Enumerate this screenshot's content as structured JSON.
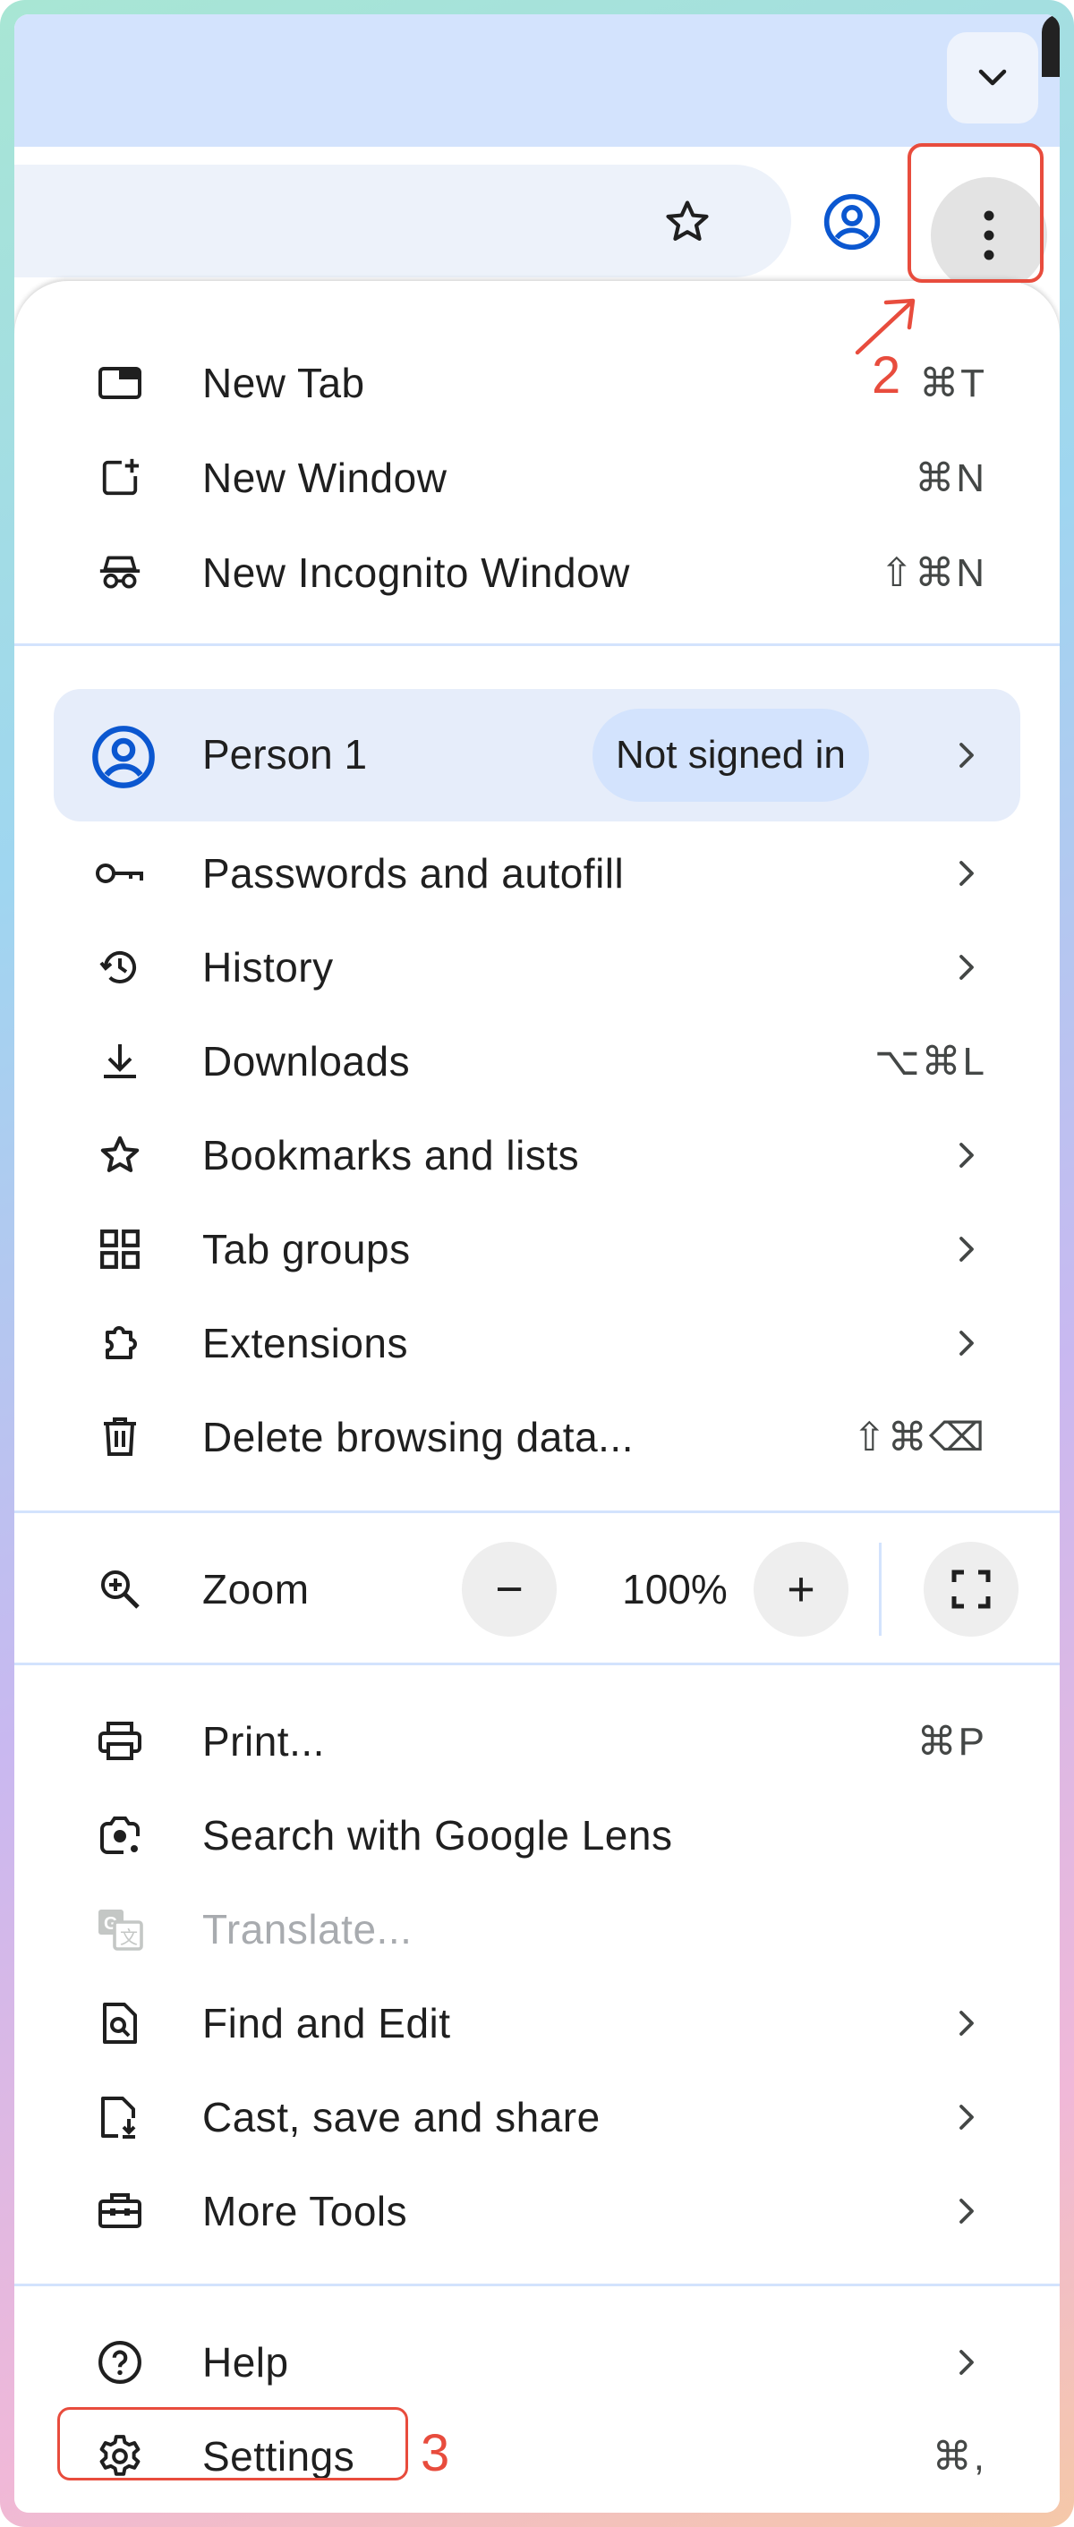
{
  "toolbar": {
    "tab_dropdown_icon": "chevron-down-icon",
    "bookmark_icon": "star-outline-icon",
    "profile_icon": "account-circle-icon",
    "menu_icon": "vertical-dots-icon"
  },
  "menu": {
    "group1": [
      {
        "icon": "new-tab-icon",
        "label": "New Tab",
        "shortcut": "⌘T"
      },
      {
        "icon": "new-window-icon",
        "label": "New Window",
        "shortcut": "⌘N"
      },
      {
        "icon": "incognito-icon",
        "label": "New Incognito Window",
        "shortcut": "⇧⌘N"
      }
    ],
    "profile": {
      "name": "Person 1",
      "status": "Not signed in"
    },
    "group2": [
      {
        "icon": "key-icon",
        "label": "Passwords and autofill"
      },
      {
        "icon": "history-icon",
        "label": "History"
      },
      {
        "icon": "download-icon",
        "label": "Downloads",
        "shortcut": "⌥⌘L"
      },
      {
        "icon": "star-icon",
        "label": "Bookmarks and lists"
      },
      {
        "icon": "tab-groups-icon",
        "label": "Tab groups"
      },
      {
        "icon": "extensions-icon",
        "label": "Extensions"
      },
      {
        "icon": "trash-icon",
        "label": "Delete browsing data...",
        "shortcut": "⇧⌘⌫"
      }
    ],
    "zoom": {
      "label": "Zoom",
      "minus": "−",
      "value": "100%",
      "plus": "+"
    },
    "group3": [
      {
        "icon": "print-icon",
        "label": "Print...",
        "shortcut": "⌘P"
      },
      {
        "icon": "google-lens-icon",
        "label": "Search with Google Lens"
      },
      {
        "icon": "translate-icon",
        "label": "Translate..."
      },
      {
        "icon": "find-icon",
        "label": "Find and Edit"
      },
      {
        "icon": "cast-save-icon",
        "label": "Cast, save and share"
      },
      {
        "icon": "toolbox-icon",
        "label": "More Tools"
      }
    ],
    "group4": [
      {
        "icon": "help-icon",
        "label": "Help"
      },
      {
        "icon": "settings-gear-icon",
        "label": "Settings",
        "shortcut": "⌘,"
      }
    ]
  },
  "annotations": {
    "step2": "2",
    "step3": "3",
    "color": "#e84c3d"
  },
  "colors": {
    "accent": "#0b57d0",
    "tabstrip": "#d3e3fd",
    "badge": "#d3e3fd"
  }
}
